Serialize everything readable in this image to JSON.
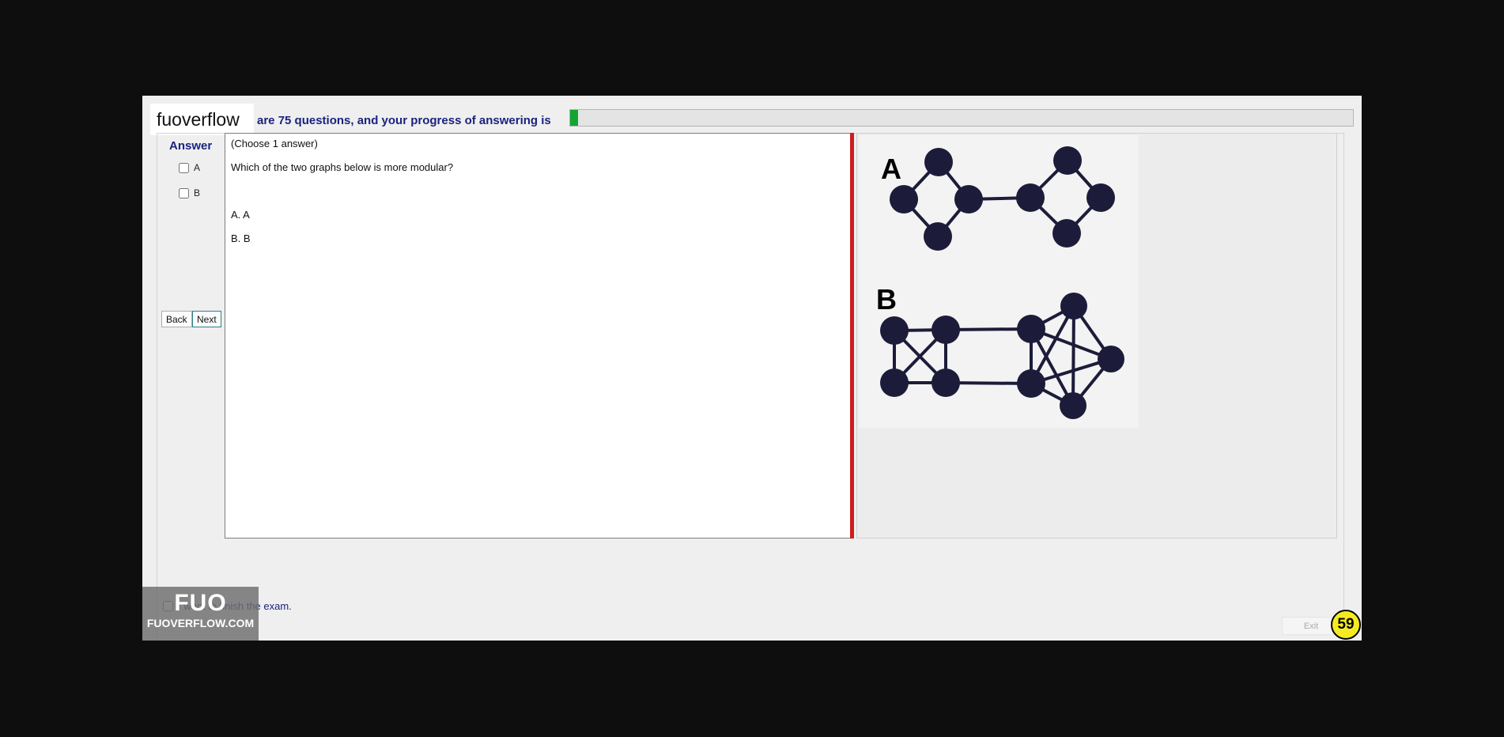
{
  "brand": "fuoverflow",
  "progress": {
    "text": "are 75 questions, and your progress of answering is",
    "fraction": 0.01
  },
  "answer": {
    "title": "Answer",
    "options": [
      "A",
      "B"
    ]
  },
  "nav": {
    "back": "Back",
    "next": "Next"
  },
  "question": {
    "instruction": "(Choose 1 answer)",
    "text": "Which of the two graphs below is more modular?",
    "choices": [
      "A.  A",
      "B.  B"
    ]
  },
  "image": {
    "label_a": "A",
    "label_b": "B"
  },
  "finish_text": "I want to finish the exam.",
  "exit_label": "Exit",
  "timer": "59",
  "watermark": {
    "big": "FUO",
    "small": "FUOVERFLOW.COM"
  },
  "colors": {
    "accent_text": "#1a237e",
    "progress_fill": "#11a633",
    "divider": "#cc1f1f",
    "timer_bg": "#f5ea21",
    "node": "#1c1c3a"
  }
}
